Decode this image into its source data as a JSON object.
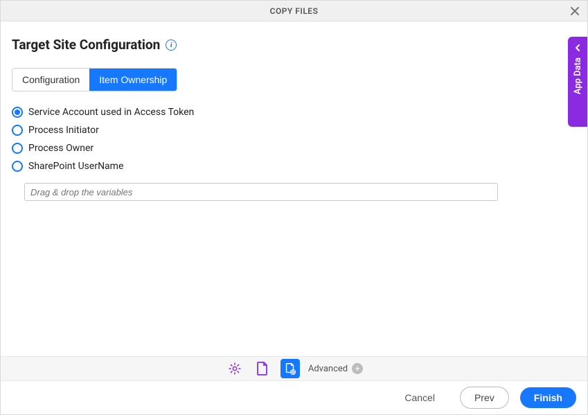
{
  "header": {
    "title": "COPY FILES"
  },
  "section": {
    "title": "Target Site Configuration"
  },
  "tabs": {
    "configuration": "Configuration",
    "item_ownership": "Item Ownership",
    "active": "item_ownership"
  },
  "ownership": {
    "options": [
      {
        "key": "service_account",
        "label": "Service Account used in Access Token",
        "checked": true
      },
      {
        "key": "process_initiator",
        "label": "Process Initiator",
        "checked": false
      },
      {
        "key": "process_owner",
        "label": "Process Owner",
        "checked": false
      },
      {
        "key": "sharepoint_username",
        "label": "SharePoint UserName",
        "checked": false
      }
    ],
    "username_input": {
      "value": "",
      "placeholder": "Drag & drop the variables"
    }
  },
  "side_panel": {
    "label": "App Data"
  },
  "advanced": {
    "label": "Advanced"
  },
  "footer": {
    "cancel": "Cancel",
    "prev": "Prev",
    "finish": "Finish"
  },
  "colors": {
    "primary": "#1677ff",
    "accent": "#8a2be2"
  }
}
